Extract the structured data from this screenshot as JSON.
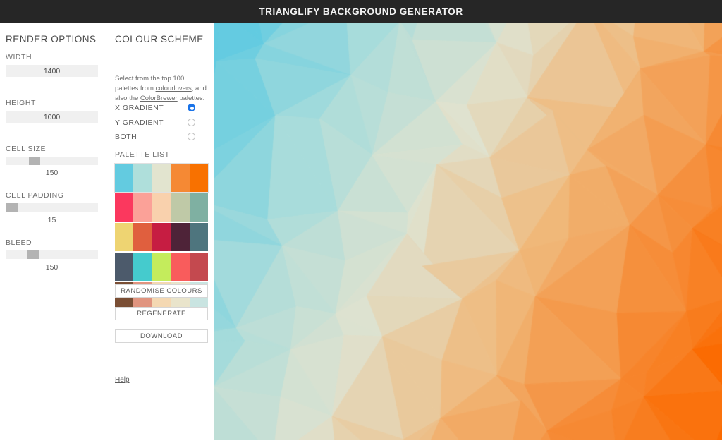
{
  "header": {
    "title": "TRIANGLIFY BACKGROUND GENERATOR"
  },
  "render_options": {
    "heading": "RENDER OPTIONS",
    "width": {
      "label": "WIDTH",
      "value": "1400"
    },
    "height": {
      "label": "HEIGHT",
      "value": "1000"
    },
    "cell_size": {
      "label": "CELL SIZE",
      "value": "150",
      "thumb_pct": 29
    },
    "cell_padding": {
      "label": "CELL PADDING",
      "value": "15",
      "thumb_pct": 1
    },
    "bleed": {
      "label": "BLEED",
      "value": "150",
      "thumb_pct": 27
    }
  },
  "colour_scheme": {
    "heading": "COLOUR SCHEME",
    "description_part1": "Select from the top 100 palettes from ",
    "link1": "colourlovers",
    "description_part2": ", and also the ",
    "link2": "ColorBrewer",
    "description_part3": " palettes.",
    "gradient_options": [
      {
        "label": "X GRADIENT",
        "checked": true
      },
      {
        "label": "Y GRADIENT",
        "checked": false
      },
      {
        "label": "BOTH",
        "checked": false
      }
    ],
    "palette_list_label": "PALETTE LIST",
    "palettes": [
      {
        "selected": true,
        "colors": [
          "#63cbe0",
          "#afdfdb",
          "#e2e4cf",
          "#f58934",
          "#f87100"
        ]
      },
      {
        "selected": false,
        "colors": [
          "#fb385e",
          "#fba198",
          "#f9d1ad",
          "#bfc9a7",
          "#7fb0a2"
        ]
      },
      {
        "selected": false,
        "colors": [
          "#eed472",
          "#e05f3e",
          "#c61d42",
          "#4e2338",
          "#4e757e"
        ]
      },
      {
        "selected": false,
        "colors": [
          "#4c5a6b",
          "#45cbcd",
          "#c4ec5c",
          "#f95c5c",
          "#c4494f"
        ]
      },
      {
        "selected": false,
        "colors": [
          "#7a4e34",
          "#e0947f",
          "#f4d8b2",
          "#e9e4cb",
          "#c9e4e1"
        ]
      }
    ],
    "buttons": [
      {
        "label": "RANDOMISE COLOURS"
      },
      {
        "label": "REGENERATE"
      },
      {
        "label": "DOWNLOAD"
      }
    ],
    "help_label": "Help"
  },
  "canvas": {
    "gradient_mode": "x",
    "ramp": [
      "#62cbe1",
      "#a9dcdb",
      "#dfe2cf",
      "#f0b87a",
      "#f68b36",
      "#fb6a00"
    ]
  }
}
